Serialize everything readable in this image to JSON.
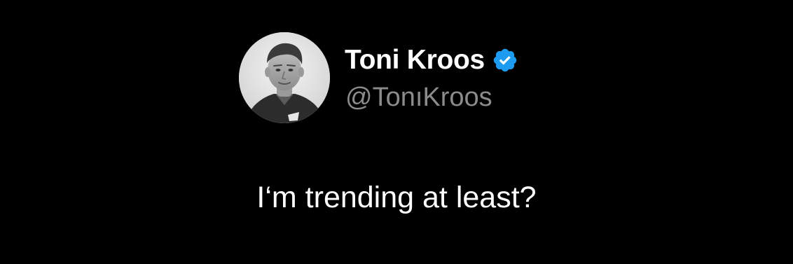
{
  "author": {
    "display_name": "Toni Kroos",
    "handle": "@TonıKroos",
    "verified": true,
    "avatar_icon": "profile-photo",
    "verified_icon": "verified-badge-icon",
    "verified_color": "#1d9bf0"
  },
  "tweet": {
    "text": "I‘m trending at least?"
  },
  "colors": {
    "background": "#000000",
    "primary_text": "#ffffff",
    "secondary_text": "#8b8b8b"
  }
}
